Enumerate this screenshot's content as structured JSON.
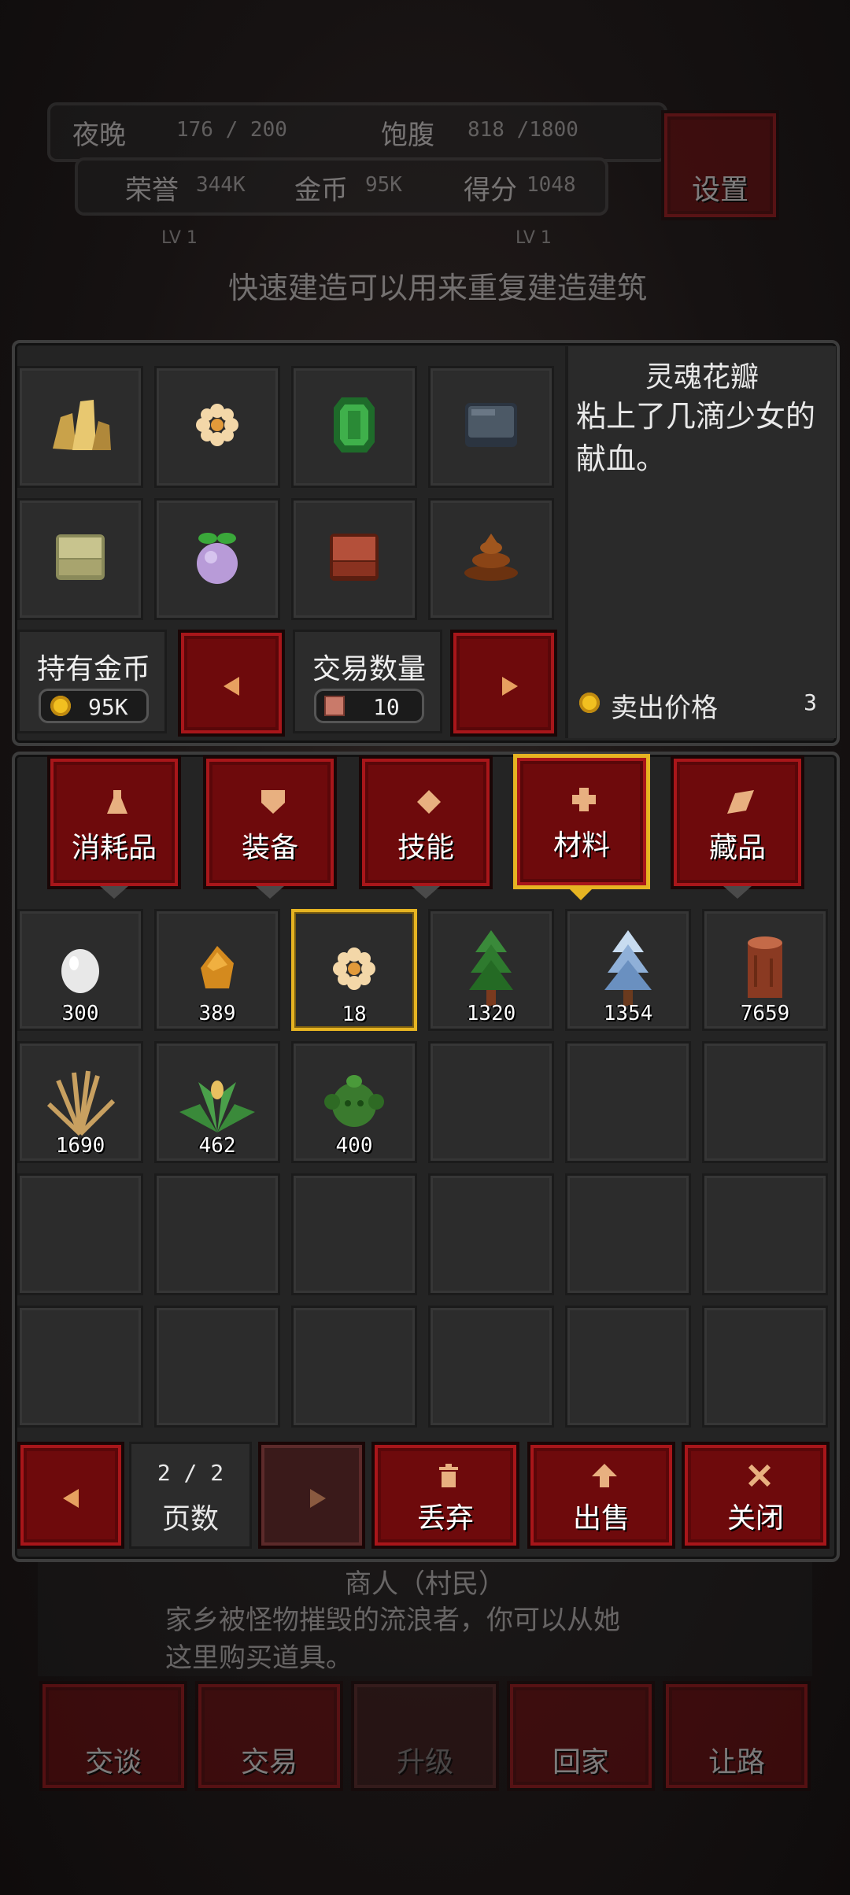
{
  "hud": {
    "night_label": "夜晚",
    "night_value": "176 / 200",
    "hunger_label": "饱腹",
    "hunger_value": "818 /1800",
    "honor_label": "荣誉",
    "honor_value": "344K",
    "gold_label": "金币",
    "gold_value": "95K",
    "score_label": "得分",
    "score_value": "1048",
    "settings_label": "设置",
    "tip": "快速建造可以用来重复建造建筑",
    "lv_left": "LV 1",
    "lv_right": "LV 1"
  },
  "shop": {
    "item_name": "灵魂花瓣",
    "item_desc": "粘上了几滴少女的献血。",
    "sell_price_label": "卖出价格",
    "sell_price_value": "3",
    "held_gold_label": "持有金币",
    "held_gold_value": "95K",
    "trade_qty_label": "交易数量",
    "trade_qty_value": "10",
    "merchant_slots": [
      {
        "icon": "gold-crystal-icon"
      },
      {
        "icon": "soul-petal-icon"
      },
      {
        "icon": "emerald-icon"
      },
      {
        "icon": "iron-block-icon"
      },
      {
        "icon": "sandstone-block-icon"
      },
      {
        "icon": "turnip-icon"
      },
      {
        "icon": "wood-block-icon"
      },
      {
        "icon": "dung-icon"
      }
    ]
  },
  "tabs": [
    {
      "label": "消耗品",
      "icon": "flask-icon"
    },
    {
      "label": "装备",
      "icon": "shield-icon"
    },
    {
      "label": "技能",
      "icon": "diamond-icon"
    },
    {
      "label": "材料",
      "icon": "cross-icon",
      "active": true
    },
    {
      "label": "藏品",
      "icon": "leaf-icon"
    }
  ],
  "inventory": [
    {
      "icon": "egg-icon",
      "qty": "300"
    },
    {
      "icon": "amber-icon",
      "qty": "389"
    },
    {
      "icon": "soul-petal-icon",
      "qty": "18",
      "selected": true
    },
    {
      "icon": "pine-tree-icon",
      "qty": "1320"
    },
    {
      "icon": "snow-pine-icon",
      "qty": "1354"
    },
    {
      "icon": "log-icon",
      "qty": "7659"
    },
    {
      "icon": "dry-grass-icon",
      "qty": "1690"
    },
    {
      "icon": "herb-icon",
      "qty": "462"
    },
    {
      "icon": "cactus-icon",
      "qty": "400"
    }
  ],
  "footer": {
    "page_value": "2 / 2",
    "page_label": "页数",
    "discard_label": "丢弃",
    "sell_label": "出售",
    "close_label": "关闭"
  },
  "merchant": {
    "title": "商人（村民）",
    "desc_line1": "家乡被怪物摧毁的流浪者，你可以从她",
    "desc_line2": "这里购买道具。",
    "actions": [
      "交谈",
      "交易",
      "升级",
      "回家",
      "让路"
    ]
  }
}
